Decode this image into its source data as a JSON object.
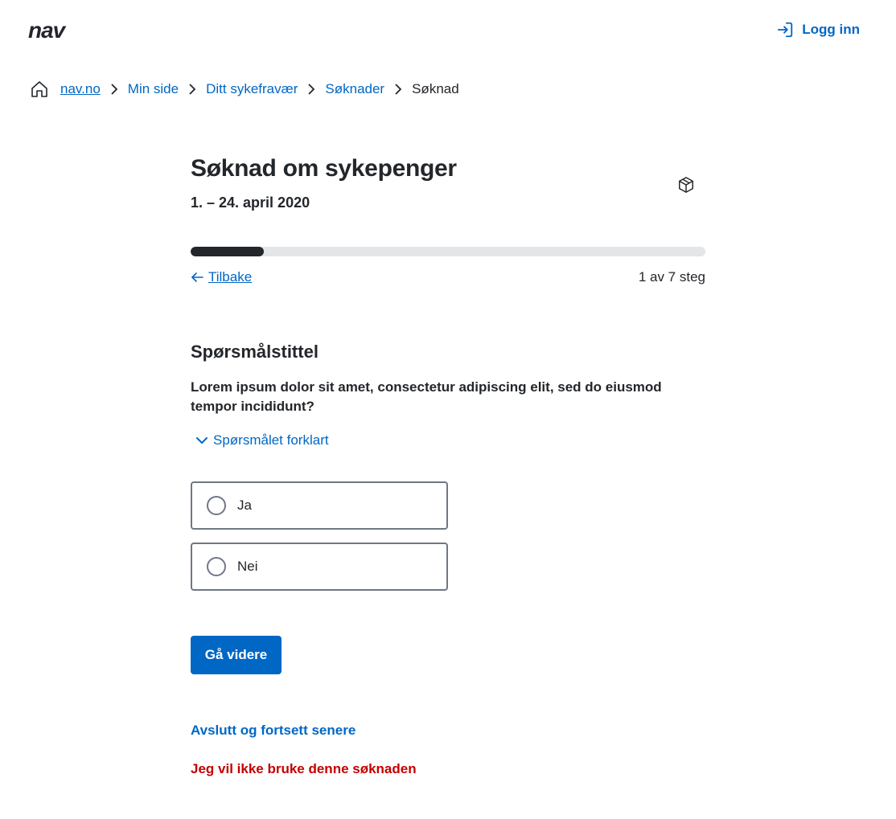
{
  "header": {
    "logo_text": "nav",
    "login_label": "Logg inn"
  },
  "breadcrumb": {
    "items": [
      {
        "label": "nav.no"
      },
      {
        "label": "Min side"
      },
      {
        "label": "Ditt sykefravær"
      },
      {
        "label": "Søknader"
      },
      {
        "label": "Søknad"
      }
    ]
  },
  "form": {
    "title": "Søknad om sykepenger",
    "period": "1. – 24. april 2020",
    "progress": {
      "current_step": 1,
      "total_steps": 7,
      "fraction": 0.142,
      "label": "1 av 7 steg"
    },
    "back_label": "Tilbake",
    "question_title": "Spørsmålstittel",
    "question_text": "Lorem ipsum dolor sit amet, consectetur adipiscing elit, sed do eiusmod tempor incididunt?",
    "explain_label": "Spørsmålet forklart",
    "options": [
      {
        "label": "Ja",
        "selected": false
      },
      {
        "label": "Nei",
        "selected": false
      }
    ],
    "next_label": "Gå videre",
    "save_later_label": "Avslutt og fortsett senere",
    "discard_label": "Jeg vil ikke bruke denne søknaden"
  },
  "icons": {
    "login": "login-icon",
    "home": "home-icon",
    "chevron": "chevron-right-icon",
    "cube": "cube-icon",
    "back_arrow": "arrow-left-icon",
    "expand": "chevron-down-icon"
  },
  "colors": {
    "link": "#0067c5",
    "text": "#23262a",
    "danger": "#c30000",
    "progress_track": "#e4e5e7",
    "progress_fill": "#23262a",
    "border": "#6f7785"
  }
}
